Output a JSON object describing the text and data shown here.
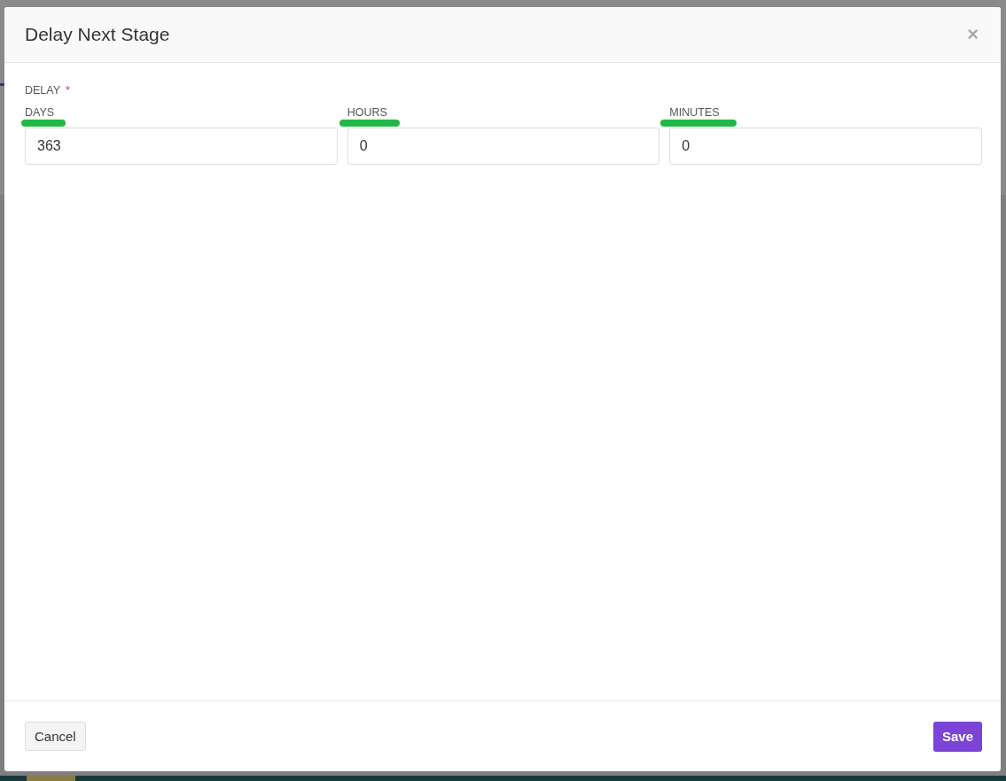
{
  "dialog": {
    "title": "Delay Next Stage",
    "close": "×"
  },
  "delay": {
    "label": "DELAY",
    "required": true,
    "required_mark": "*",
    "fields": [
      {
        "label": "DAYS",
        "value": "363"
      },
      {
        "label": "HOURS",
        "value": "0"
      },
      {
        "label": "MINUTES",
        "value": "0"
      }
    ]
  },
  "buttons": {
    "cancel": "Cancel",
    "save": "Save"
  }
}
